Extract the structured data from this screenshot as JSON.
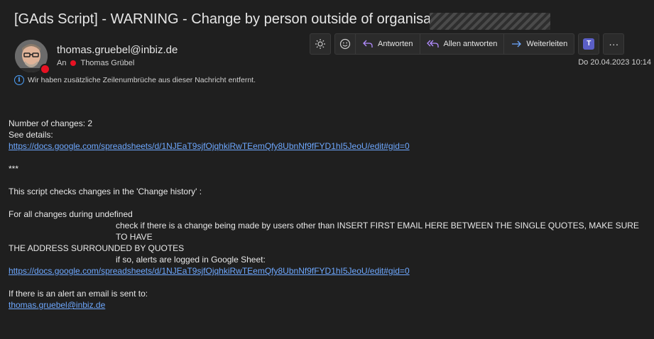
{
  "header": {
    "subject": "[GAds Script] - WARNING - Change by person outside of organisation |",
    "from": "thomas.gruebel@inbiz.de",
    "to_label": "An",
    "to_name": "Thomas Grübel",
    "info_text": "Wir haben zusätzliche Zeilenumbrüche aus dieser Nachricht entfernt.",
    "date": "Do 20.04.2023 10:14"
  },
  "toolbar": {
    "sun_icon": "sun-icon",
    "emoji_icon": "emoji-icon",
    "reply_label": "Antworten",
    "reply_all_label": "Allen antworten",
    "forward_label": "Weiterleiten",
    "teams_icon": "teams-icon",
    "teams_letter": "T",
    "more_label": "···"
  },
  "body": {
    "line1": "Number of changes: 2",
    "line2": "See details:",
    "link1": "https://docs.google.com/spreadsheets/d/1NJEaT9sjfOjqhkiRwTEemQfy8UbnNf9fFYD1hI5JeoU/edit#gid=0",
    "stars": "***",
    "line3": "This script checks changes in the 'Change history' :",
    "line4": "For all changes during undefined",
    "line5": "check if there is a change being made by users other than INSERT FIRST EMAIL HERE BETWEEN THE SINGLE QUOTES, MAKE SURE TO HAVE",
    "line6": "THE ADDRESS SURROUNDED BY QUOTES",
    "line7": "if so, alerts are logged in Google Sheet:",
    "link2": "https://docs.google.com/spreadsheets/d/1NJEaT9sjfOjqhkiRwTEemQfy8UbnNf9fFYD1hI5JeoU/edit#gid=0",
    "line8": "If there is an alert an email is sent to:",
    "email_link": "thomas.gruebel@inbiz.de"
  },
  "colors": {
    "accent": "#6ea8ff",
    "presence": "#e81123",
    "teams": "#5b5fc7"
  }
}
